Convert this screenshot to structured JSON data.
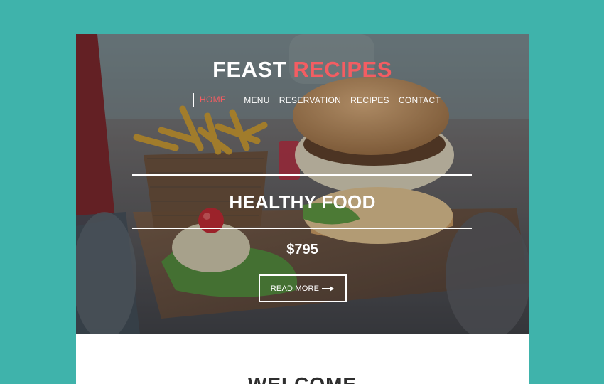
{
  "brand": {
    "word1": "FEAST",
    "word2": "RECIPES",
    "accent_color": "#f45d62"
  },
  "nav": {
    "items": [
      {
        "label": "HOME",
        "active": true
      },
      {
        "label": "MENU"
      },
      {
        "label": "RESERVATION"
      },
      {
        "label": "RECIPES"
      },
      {
        "label": "CONTACT"
      }
    ]
  },
  "hero": {
    "headline": "HEALTHY FOOD",
    "price": "$795",
    "cta_label": "READ MORE",
    "cta_icon": "arrow-right-icon",
    "image": "burger-and-fries-photo"
  },
  "section": {
    "title": "WELCOME"
  },
  "colors": {
    "background": "#3fb3ab",
    "accent": "#f45d62",
    "text_light": "#ffffff",
    "text_dark": "#2e2e2e"
  }
}
